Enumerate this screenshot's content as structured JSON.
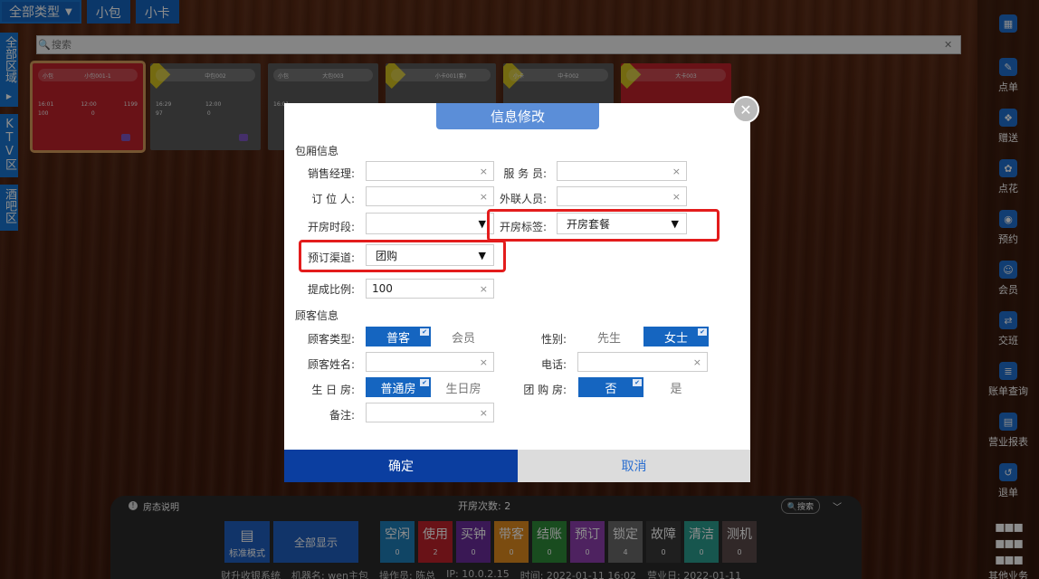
{
  "topbar": {
    "type_label": "全部类型",
    "tabs": [
      "小包",
      "小卡"
    ]
  },
  "left_regions": [
    {
      "label": "全部区域"
    },
    {
      "label": "KTV区"
    },
    {
      "label": "酒吧区"
    }
  ],
  "search": {
    "placeholder": "搜索"
  },
  "rooms": [
    {
      "kind": "小包",
      "name": "小包001-1",
      "t1": "16:01",
      "t2": "12:00",
      "t3": "1199",
      "v1": "100",
      "v2": "0"
    },
    {
      "kind": "",
      "name": "中包002",
      "t1": "16:29",
      "t2": "12:00",
      "t3": "",
      "v1": "97",
      "v2": "0"
    },
    {
      "kind": "小包",
      "name": "大包003",
      "t1": "16:01",
      "t2": "",
      "t3": "",
      "v1": "",
      "v2": ""
    },
    {
      "kind": "",
      "name": "小卡001(套)",
      "t1": "",
      "t2": "",
      "t3": "",
      "v1": "",
      "v2": ""
    },
    {
      "kind": "小卡",
      "name": "中卡002",
      "t1": "",
      "t2": "",
      "t3": "",
      "v1": "",
      "v2": ""
    },
    {
      "kind": "",
      "name": "大卡003",
      "t1": "",
      "t2": "",
      "t3": "",
      "v1": "",
      "v2": ""
    }
  ],
  "rightbar": [
    {
      "label": "",
      "icon": "grid-icon"
    },
    {
      "label": "点单",
      "icon": "order-icon"
    },
    {
      "label": "赠送",
      "icon": "gift-icon"
    },
    {
      "label": "点花",
      "icon": "flower-icon"
    },
    {
      "label": "预约",
      "icon": "reserve-icon"
    },
    {
      "label": "会员",
      "icon": "member-icon"
    },
    {
      "label": "交班",
      "icon": "shift-icon"
    },
    {
      "label": "账单查询",
      "icon": "bill-icon"
    },
    {
      "label": "营业报表",
      "icon": "report-icon"
    },
    {
      "label": "退单",
      "icon": "refund-icon"
    }
  ],
  "rightbar_other": "其他业务",
  "bottom": {
    "info": "房态说明",
    "count": "开房次数: 2",
    "search": "搜索",
    "mode_label": "标准模式",
    "all_label": "全部显示",
    "statuses": [
      {
        "label": "空闲",
        "count": "0",
        "color": "#1e7fb8"
      },
      {
        "label": "使用",
        "count": "2",
        "color": "#c0212b"
      },
      {
        "label": "买钟",
        "count": "0",
        "color": "#6a2d9c"
      },
      {
        "label": "带客",
        "count": "0",
        "color": "#e08a1e"
      },
      {
        "label": "结账",
        "count": "0",
        "color": "#2e8b3a"
      },
      {
        "label": "预订",
        "count": "0",
        "color": "#8e3fb0"
      },
      {
        "label": "锁定",
        "count": "4",
        "color": "#6b6b6b"
      },
      {
        "label": "故障",
        "count": "0",
        "color": "#3a3a3a"
      },
      {
        "label": "清洁",
        "count": "0",
        "color": "#2a9d8f"
      },
      {
        "label": "测机",
        "count": "0",
        "color": "#5a4a4a"
      }
    ],
    "footer": [
      "财升收银系统",
      "机器名: wen主包",
      "操作员: 陈总",
      "IP: 10.0.2.15",
      "时间: 2022-01-11 16:02",
      "营业日: 2022-01-11"
    ]
  },
  "dialog": {
    "title": "信息修改",
    "section_room": "包厢信息",
    "sales_manager": {
      "label": "销售经理:",
      "value": ""
    },
    "server": {
      "label": "服 务 员:",
      "value": ""
    },
    "booker": {
      "label": "订 位 人:",
      "value": ""
    },
    "liaison": {
      "label": "外联人员:",
      "value": ""
    },
    "period": {
      "label": "开房时段:",
      "value": ""
    },
    "room_tag": {
      "label": "开房标签:",
      "value": "开房套餐"
    },
    "channel": {
      "label": "预订渠道:",
      "value": "团购"
    },
    "commission": {
      "label": "提成比例:",
      "value": "100"
    },
    "section_customer": "顾客信息",
    "customer_type": {
      "label": "顾客类型:",
      "options": [
        "普客",
        "会员"
      ]
    },
    "gender": {
      "label": "性别:",
      "options": [
        "先生",
        "女士"
      ]
    },
    "customer_name": {
      "label": "顾客姓名:",
      "value": ""
    },
    "phone": {
      "label": "电话:",
      "value": ""
    },
    "birthday": {
      "label": "生 日 房:",
      "options": [
        "普通房",
        "生日房"
      ]
    },
    "group": {
      "label": "团 购 房:",
      "options": [
        "否",
        "是"
      ]
    },
    "note": {
      "label": "备注:",
      "value": ""
    },
    "clear_mark": "×",
    "ok": "确定",
    "cancel": "取消"
  },
  "colors": {
    "primary": "#1565c0",
    "highlight": "#e31c1c",
    "ok": "#0b3ea0"
  }
}
